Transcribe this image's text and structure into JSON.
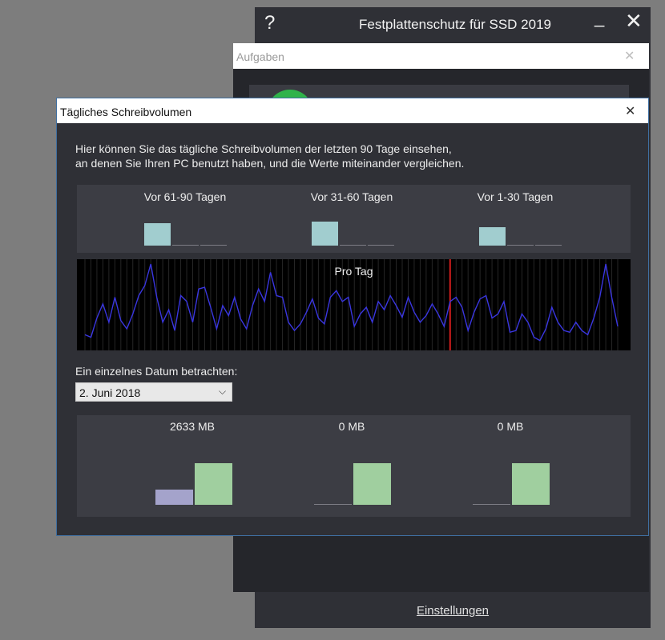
{
  "main_window": {
    "title": "Festplattenschutz für SSD 2019",
    "help_label": "?",
    "minimize_label": "_",
    "close_label": "✕",
    "settings_link": "Einstellungen"
  },
  "tasks_window": {
    "title": "Aufgaben",
    "close_label": "✕"
  },
  "dialog": {
    "title": "Tägliches Schreibvolumen",
    "close_label": "✕",
    "description_line1": "Hier können Sie das tägliche Schreibvolumen der letzten 90 Tage einsehen,",
    "description_line2": "an denen Sie Ihren PC benutzt haben, und die Werte miteinander vergleichen.",
    "periods": [
      {
        "label": "Vor 61-90 Tagen",
        "bar_levels": [
          0.92,
          0,
          0
        ]
      },
      {
        "label": "Vor 31-60 Tagen",
        "bar_levels": [
          1.0,
          0,
          0
        ]
      },
      {
        "label": "Vor 1-30 Tagen",
        "bar_levels": [
          0.78,
          0,
          0
        ]
      }
    ],
    "chart_label": "Pro Tag",
    "single_date_label": "Ein einzelnes Datum betrachten:",
    "date_value": "2. Juni 2018",
    "mb_values": [
      {
        "label": "2633 MB",
        "bar_levels": [
          0.36,
          1.0
        ]
      },
      {
        "label": "0 MB",
        "bar_levels": [
          0,
          1.0
        ]
      },
      {
        "label": "0 MB",
        "bar_levels": [
          0,
          1.0
        ]
      }
    ]
  },
  "colors": {
    "period_bar": "#a1cdcf",
    "mb_purple": "#a4a3cb",
    "mb_green": "#a0cf9f",
    "chart_line": "#3a36e0",
    "chart_marker": "#d21c1c"
  },
  "chart_data": {
    "type": "line",
    "series": [
      {
        "values": [
          0.15,
          0.12,
          0.35,
          0.52,
          0.3,
          0.6,
          0.32,
          0.22,
          0.4,
          0.62,
          0.74,
          1.0,
          0.6,
          0.3,
          0.45,
          0.2,
          0.62,
          0.55,
          0.3,
          0.7,
          0.72,
          0.48,
          0.22,
          0.5,
          0.38,
          0.6,
          0.34,
          0.22,
          0.5,
          0.7,
          0.55,
          0.9,
          0.62,
          0.6,
          0.3,
          0.2,
          0.28,
          0.42,
          0.58,
          0.35,
          0.28,
          0.6,
          0.68,
          0.55,
          0.6,
          0.25,
          0.4,
          0.48,
          0.3,
          0.55,
          0.45,
          0.62,
          0.5,
          0.36,
          0.6,
          0.42,
          0.3,
          0.38,
          0.52,
          0.4,
          0.25,
          0.55,
          0.6,
          0.48,
          0.2,
          0.42,
          0.58,
          0.62,
          0.35,
          0.4,
          0.55,
          0.18,
          0.2,
          0.4,
          0.3,
          0.12,
          0.08,
          0.22,
          0.48,
          0.3,
          0.2,
          0.18,
          0.3,
          0.2,
          0.15,
          0.35,
          0.6,
          1.0,
          0.6,
          0.25
        ]
      }
    ],
    "marker_index": 61,
    "ylim": [
      0,
      1
    ],
    "grid": true
  }
}
